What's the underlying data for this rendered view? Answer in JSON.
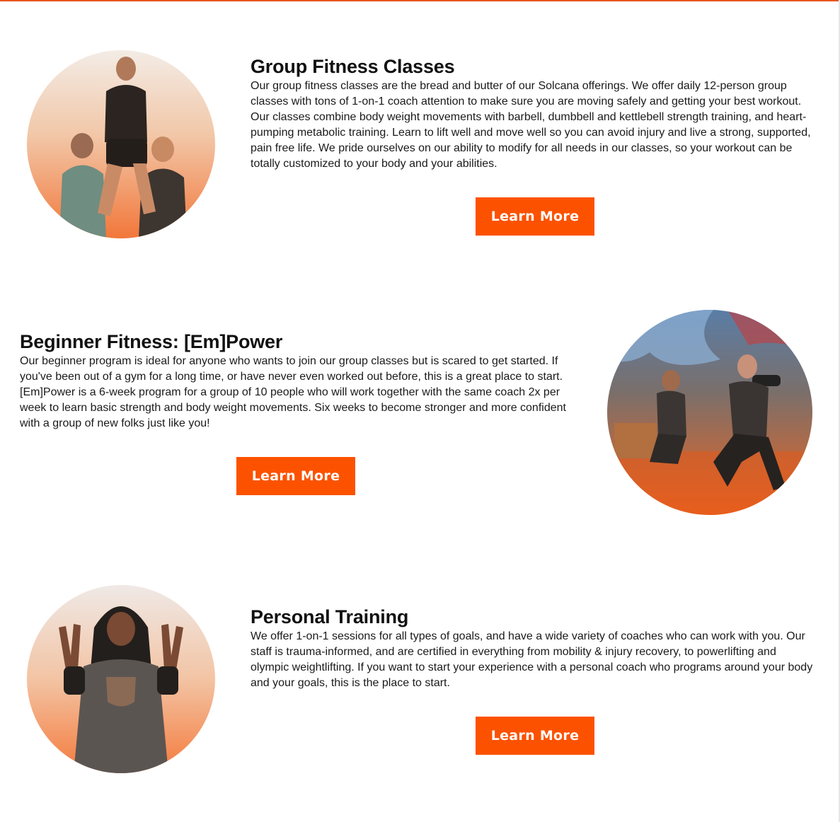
{
  "theme": {
    "accent": "#fc5200",
    "rule": "#e9561f",
    "text": "#111111"
  },
  "sections": [
    {
      "title": "Group Fitness Classes",
      "body": "Our group fitness classes are the bread and butter of our Solcana offerings. We offer daily 12-person group classes with tons of 1-on-1 coach attention to make sure you are moving safely and getting your best workout. Our classes combine body weight movements with barbell, dumbbell and kettlebell strength training, and heart-pumping metabolic training. Learn to lift well and move well so you can avoid injury and live a strong, supported, pain free life. We pride ourselves on our ability to modify for all needs in our classes, so your workout can be totally customized to your body and your abilities.",
      "button_label": "Learn More",
      "image": "photo-three-women-lifting"
    },
    {
      "title": "Beginner Fitness: [Em]Power",
      "body": "Our beginner program is ideal for anyone who wants to join our group classes but is scared to get started. If you've been out of a gym for a long time, or have never even worked out before, this is a great place to start. [Em]Power is a 6-week program for a group of 10 people who will work together with the same coach 2x per week to learn basic strength and body weight movements. Six weeks to become stronger and more confident with a group of new folks just like you!",
      "button_label": "Learn More",
      "image": "photo-dumbbell-squat"
    },
    {
      "title": "Personal Training",
      "body": "We offer 1-on-1 sessions for all types of goals, and have a wide variety of coaches who can work with you. Our staff is trauma-informed, and are certified in everything from mobility & injury recovery, to powerlifting and olympic weightlifting. If you want to start your experience with a personal coach who programs around your body and your goals, this is the place to start.",
      "button_label": "Learn More",
      "image": "photo-peace-signs"
    }
  ]
}
